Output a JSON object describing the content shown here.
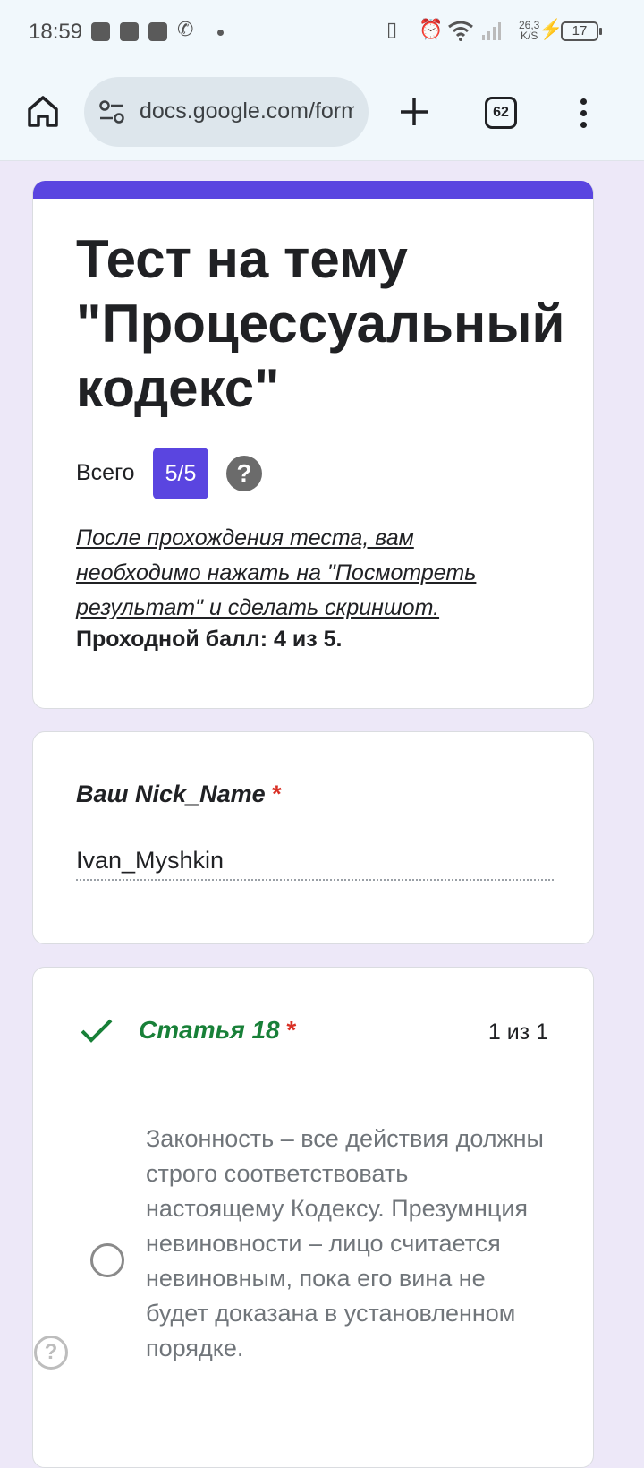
{
  "status_bar": {
    "time": "18:59",
    "net_speed_value": "26,3",
    "net_speed_unit": "K/S",
    "battery": "17"
  },
  "browser": {
    "url": "docs.google.com/forms",
    "tab_count": "62"
  },
  "form": {
    "accent_color": "#5a45e0",
    "title": "Тест на тему \"Процессуальный кодекс\"",
    "score_label": "Всего",
    "score_value": "5/5",
    "score_help": "?",
    "description": "После прохождения теста, вам необходимо нажать на \"Посмотреть результат\" и сделать скриншот.",
    "passing_score": "Проходной балл: 4 из 5."
  },
  "questions": [
    {
      "label": "Ваш Nick_Name",
      "required_mark": "*",
      "answer": "Ivan_Myshkin"
    },
    {
      "label": "Статья 18",
      "required_mark": "*",
      "points": "1 из 1",
      "status_icon": "check-icon",
      "options": [
        {
          "text": "Законность – все действия должны строго соответствовать настоящему Кодексу. Презумнция невиновности – лицо считается невиновным, пока его вина не будет доказана в установленном порядке."
        }
      ]
    }
  ],
  "floating_help": "?"
}
